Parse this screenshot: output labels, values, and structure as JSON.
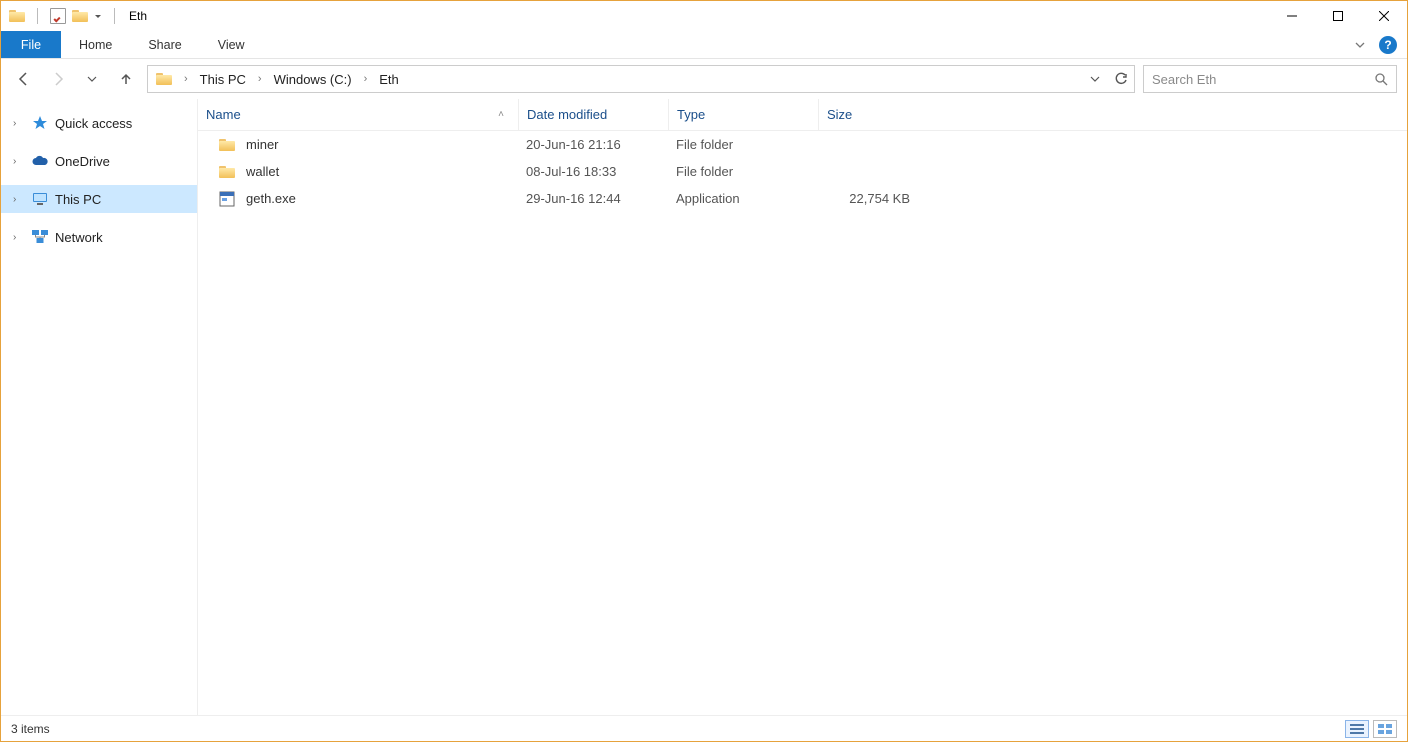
{
  "title": "Eth",
  "ribbon": {
    "file": "File",
    "tabs": [
      "Home",
      "Share",
      "View"
    ]
  },
  "breadcrumb": [
    "This PC",
    "Windows (C:)",
    "Eth"
  ],
  "search_placeholder": "Search Eth",
  "columns": {
    "name": "Name",
    "date": "Date modified",
    "type": "Type",
    "size": "Size"
  },
  "sort_column": "name",
  "nav": [
    {
      "label": "Quick access",
      "icon": "star",
      "selected": false
    },
    {
      "label": "OneDrive",
      "icon": "cloud",
      "selected": false
    },
    {
      "label": "This PC",
      "icon": "pc",
      "selected": true
    },
    {
      "label": "Network",
      "icon": "network",
      "selected": false
    }
  ],
  "rows": [
    {
      "name": "miner",
      "date": "20-Jun-16 21:16",
      "type": "File folder",
      "size": "",
      "icon": "folder"
    },
    {
      "name": "wallet",
      "date": "08-Jul-16 18:33",
      "type": "File folder",
      "size": "",
      "icon": "folder"
    },
    {
      "name": "geth.exe",
      "date": "29-Jun-16 12:44",
      "type": "Application",
      "size": "22,754 KB",
      "icon": "app"
    }
  ],
  "status": "3 items"
}
